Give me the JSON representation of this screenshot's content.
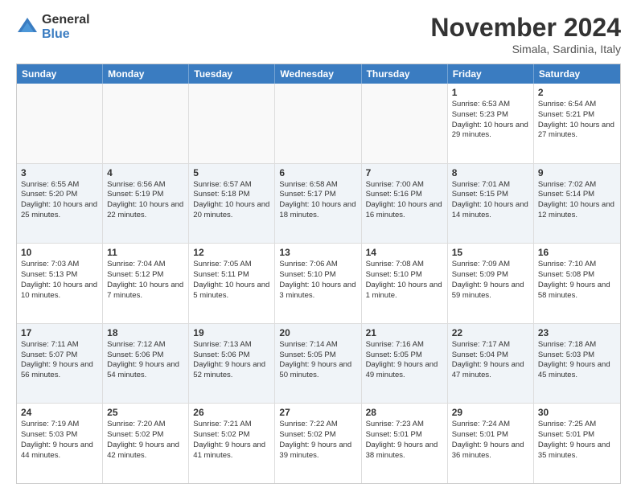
{
  "header": {
    "logo_line1": "General",
    "logo_line2": "Blue",
    "month": "November 2024",
    "location": "Simala, Sardinia, Italy"
  },
  "days_of_week": [
    "Sunday",
    "Monday",
    "Tuesday",
    "Wednesday",
    "Thursday",
    "Friday",
    "Saturday"
  ],
  "weeks": [
    [
      {
        "day": "",
        "info": ""
      },
      {
        "day": "",
        "info": ""
      },
      {
        "day": "",
        "info": ""
      },
      {
        "day": "",
        "info": ""
      },
      {
        "day": "",
        "info": ""
      },
      {
        "day": "1",
        "info": "Sunrise: 6:53 AM\nSunset: 5:23 PM\nDaylight: 10 hours and 29 minutes."
      },
      {
        "day": "2",
        "info": "Sunrise: 6:54 AM\nSunset: 5:21 PM\nDaylight: 10 hours and 27 minutes."
      }
    ],
    [
      {
        "day": "3",
        "info": "Sunrise: 6:55 AM\nSunset: 5:20 PM\nDaylight: 10 hours and 25 minutes."
      },
      {
        "day": "4",
        "info": "Sunrise: 6:56 AM\nSunset: 5:19 PM\nDaylight: 10 hours and 22 minutes."
      },
      {
        "day": "5",
        "info": "Sunrise: 6:57 AM\nSunset: 5:18 PM\nDaylight: 10 hours and 20 minutes."
      },
      {
        "day": "6",
        "info": "Sunrise: 6:58 AM\nSunset: 5:17 PM\nDaylight: 10 hours and 18 minutes."
      },
      {
        "day": "7",
        "info": "Sunrise: 7:00 AM\nSunset: 5:16 PM\nDaylight: 10 hours and 16 minutes."
      },
      {
        "day": "8",
        "info": "Sunrise: 7:01 AM\nSunset: 5:15 PM\nDaylight: 10 hours and 14 minutes."
      },
      {
        "day": "9",
        "info": "Sunrise: 7:02 AM\nSunset: 5:14 PM\nDaylight: 10 hours and 12 minutes."
      }
    ],
    [
      {
        "day": "10",
        "info": "Sunrise: 7:03 AM\nSunset: 5:13 PM\nDaylight: 10 hours and 10 minutes."
      },
      {
        "day": "11",
        "info": "Sunrise: 7:04 AM\nSunset: 5:12 PM\nDaylight: 10 hours and 7 minutes."
      },
      {
        "day": "12",
        "info": "Sunrise: 7:05 AM\nSunset: 5:11 PM\nDaylight: 10 hours and 5 minutes."
      },
      {
        "day": "13",
        "info": "Sunrise: 7:06 AM\nSunset: 5:10 PM\nDaylight: 10 hours and 3 minutes."
      },
      {
        "day": "14",
        "info": "Sunrise: 7:08 AM\nSunset: 5:10 PM\nDaylight: 10 hours and 1 minute."
      },
      {
        "day": "15",
        "info": "Sunrise: 7:09 AM\nSunset: 5:09 PM\nDaylight: 9 hours and 59 minutes."
      },
      {
        "day": "16",
        "info": "Sunrise: 7:10 AM\nSunset: 5:08 PM\nDaylight: 9 hours and 58 minutes."
      }
    ],
    [
      {
        "day": "17",
        "info": "Sunrise: 7:11 AM\nSunset: 5:07 PM\nDaylight: 9 hours and 56 minutes."
      },
      {
        "day": "18",
        "info": "Sunrise: 7:12 AM\nSunset: 5:06 PM\nDaylight: 9 hours and 54 minutes."
      },
      {
        "day": "19",
        "info": "Sunrise: 7:13 AM\nSunset: 5:06 PM\nDaylight: 9 hours and 52 minutes."
      },
      {
        "day": "20",
        "info": "Sunrise: 7:14 AM\nSunset: 5:05 PM\nDaylight: 9 hours and 50 minutes."
      },
      {
        "day": "21",
        "info": "Sunrise: 7:16 AM\nSunset: 5:05 PM\nDaylight: 9 hours and 49 minutes."
      },
      {
        "day": "22",
        "info": "Sunrise: 7:17 AM\nSunset: 5:04 PM\nDaylight: 9 hours and 47 minutes."
      },
      {
        "day": "23",
        "info": "Sunrise: 7:18 AM\nSunset: 5:03 PM\nDaylight: 9 hours and 45 minutes."
      }
    ],
    [
      {
        "day": "24",
        "info": "Sunrise: 7:19 AM\nSunset: 5:03 PM\nDaylight: 9 hours and 44 minutes."
      },
      {
        "day": "25",
        "info": "Sunrise: 7:20 AM\nSunset: 5:02 PM\nDaylight: 9 hours and 42 minutes."
      },
      {
        "day": "26",
        "info": "Sunrise: 7:21 AM\nSunset: 5:02 PM\nDaylight: 9 hours and 41 minutes."
      },
      {
        "day": "27",
        "info": "Sunrise: 7:22 AM\nSunset: 5:02 PM\nDaylight: 9 hours and 39 minutes."
      },
      {
        "day": "28",
        "info": "Sunrise: 7:23 AM\nSunset: 5:01 PM\nDaylight: 9 hours and 38 minutes."
      },
      {
        "day": "29",
        "info": "Sunrise: 7:24 AM\nSunset: 5:01 PM\nDaylight: 9 hours and 36 minutes."
      },
      {
        "day": "30",
        "info": "Sunrise: 7:25 AM\nSunset: 5:01 PM\nDaylight: 9 hours and 35 minutes."
      }
    ]
  ]
}
